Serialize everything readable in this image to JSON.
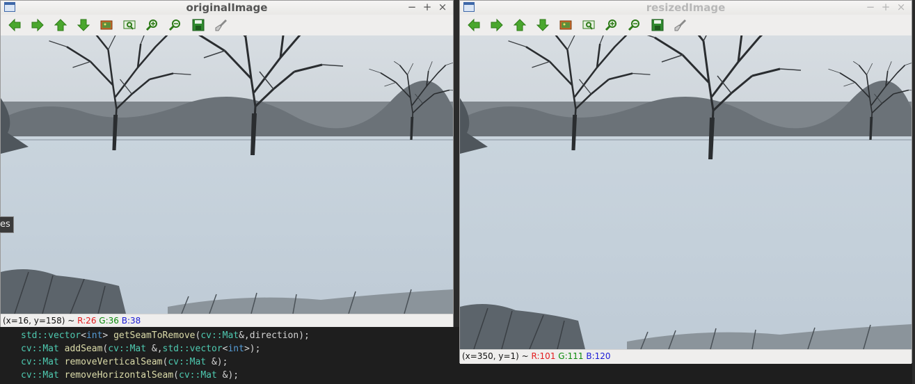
{
  "colors": {
    "red": "#e31a1c",
    "green": "#0a8a0a",
    "blue": "#1a1ad6"
  },
  "toolbar_icons": [
    "arrow-left-icon",
    "arrow-right-icon",
    "arrow-up-icon",
    "arrow-down-icon",
    "image-icon",
    "zoom-fit-icon",
    "zoom-in-icon",
    "zoom-out-icon",
    "save-icon",
    "brush-icon"
  ],
  "window_left": {
    "title": "originalImage",
    "minimize": "−",
    "maximize": "+",
    "close": "×",
    "status": {
      "coords": "(x=16, y=158) ~ ",
      "r": "R:26",
      "g": "G:36",
      "b": "B:38"
    }
  },
  "window_right": {
    "title": "resizedImage",
    "minimize": "−",
    "maximize": "+",
    "close": "×",
    "status": {
      "coords": "(x=350, y=1) ~ ",
      "r": "R:101",
      "g": "G:111",
      "b": "B:120"
    }
  },
  "tooltip": {
    "text": "es"
  },
  "code": {
    "l1": {
      "ns": "std::",
      "type": "vector",
      "lt": "<",
      "int": "int",
      "gt": ">",
      "fn": " getSeamToRemove",
      "open": "(",
      "ns2": "cv::",
      "type2": "Mat",
      "rest": "&,direction);"
    },
    "l2": {
      "ns": "cv::",
      "type": "Mat",
      "fn": " addSeam",
      "open": "(",
      "ns2": "cv::",
      "type2": "Mat",
      "mid": " &,",
      "ns3": "std::",
      "type3": "vector",
      "lt": "<",
      "int": "int",
      "rest": ">);"
    },
    "l3": {
      "ns": "cv::",
      "type": "Mat",
      "fn": " removeVerticalSeam",
      "open": "(",
      "ns2": "cv::",
      "type2": "Mat",
      "rest": " &);"
    },
    "l4": {
      "ns": "cv::",
      "type": "Mat",
      "fn": " removeHorizontalSeam",
      "open": "(",
      "ns2": "cv::",
      "type2": "Mat",
      "rest": " &);"
    }
  }
}
